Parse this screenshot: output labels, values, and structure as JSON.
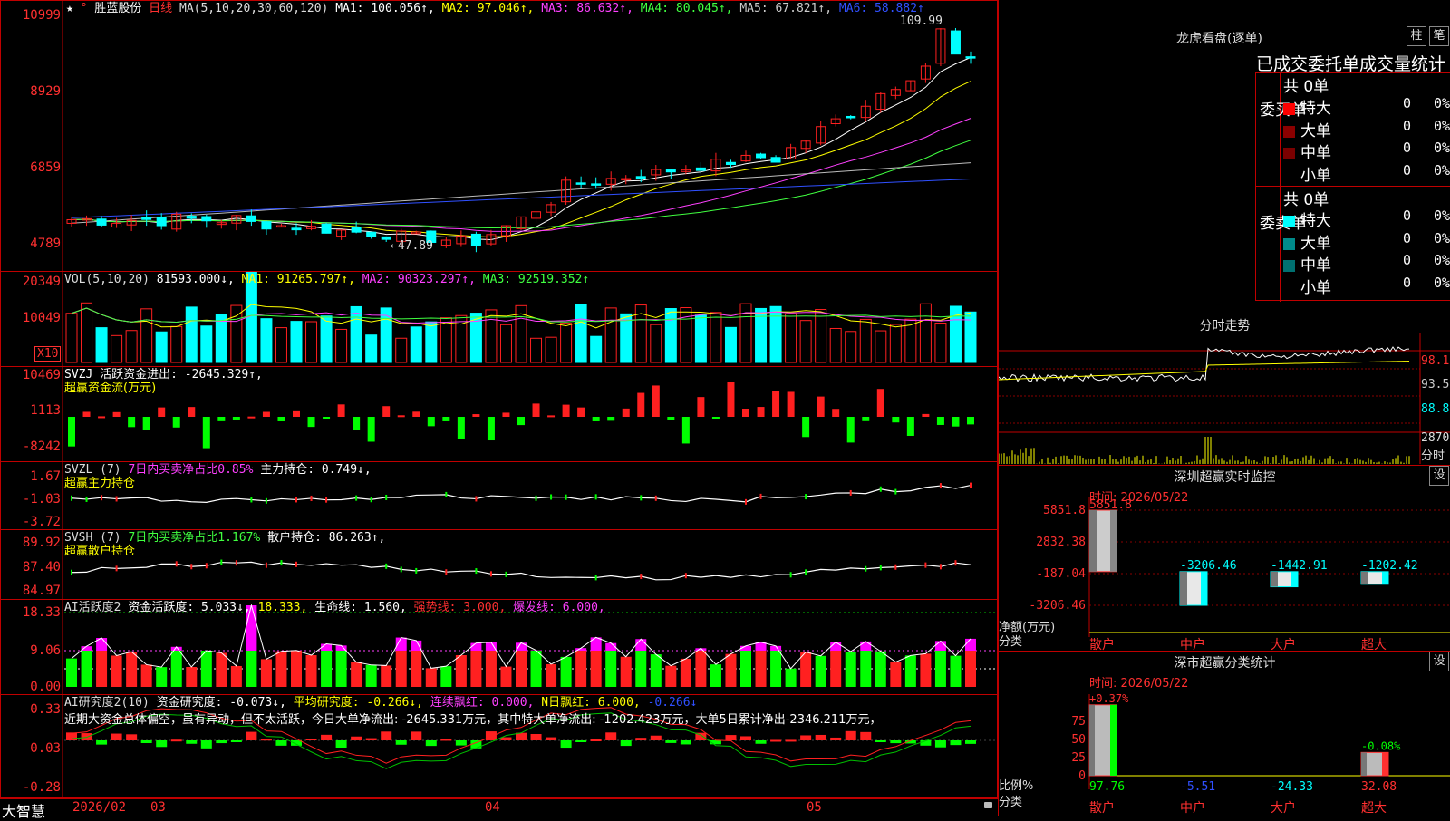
{
  "stock": {
    "star": "★",
    "marker": "°",
    "name": "胜蓝股份",
    "period": "日线"
  },
  "main_header": {
    "ma_param": "MA(5,10,20,30,60,120)",
    "ma1": "MA1: 100.056↑,",
    "ma2": "MA2: 97.046↑,",
    "ma3": "MA3: 86.632↑,",
    "ma4": "MA4: 80.045↑,",
    "ma5": "MA5: 67.821↑,",
    "ma6": "MA6: 58.882↑"
  },
  "main_axis": [
    "10999",
    "8929",
    "6859",
    "4789"
  ],
  "annotations": {
    "high": "109.99",
    "low": "←47.89"
  },
  "vol": {
    "header": "VOL(5,10,20)",
    "value": "81593.000↓,",
    "ma1": "MA1: 91265.797↑,",
    "ma2": "MA2: 90323.297↑,",
    "ma3": "MA3: 92519.352↑",
    "axis": [
      "20349",
      "10049"
    ],
    "unit": "X10"
  },
  "svzj": {
    "header": "SVZJ  活跃资金进出: -2645.329↑,",
    "label": "超赢资金流(万元)",
    "axis": [
      "10469",
      "1113",
      "-8242"
    ]
  },
  "svzl": {
    "name": "SVZL (7)",
    "desc": "7日内买卖净占比0.85%",
    "value": "主力持仓: 0.749↓,",
    "label": "超赢主力持仓",
    "axis": [
      "1.67",
      "-1.03",
      "-3.72"
    ]
  },
  "svsh": {
    "name": "SVSH (7)",
    "desc": "7日内买卖净占比1.167%",
    "value": "散户持仓: 86.263↑,",
    "label": "超赢散户持仓",
    "axis": [
      "89.92",
      "87.40",
      "84.97"
    ]
  },
  "ai1": {
    "name": "AI活跃度2",
    "v1": "资金活跃度: 5.033↓,",
    "v2": "18.333,",
    "v3": "生命线: 1.560,",
    "v4": "强势线: 3.000,",
    "v5": "爆发线: 6.000,",
    "axis": [
      "18.33",
      "9.06",
      "0.00"
    ]
  },
  "ai2": {
    "name": "AI研究度2(10)",
    "v1": "资金研究度: -0.073↓,",
    "v2": "平均研究度: -0.266↓,",
    "v3": "连续飘红: 0.000,",
    "v4": "N日飘红: 6.000,",
    "v5": "-0.266↓",
    "comment": "近期大资金总体偏空，虽有异动，但不太活跃，今日大单净流出: -2645.331万元，其中特大单净流出: -1202.423万元，大单5日累计净出-2346.211万元，",
    "axis": [
      "0.33",
      "0.03",
      "-0.28"
    ]
  },
  "date_axis": {
    "brand": "大智慧",
    "labels": [
      "2026/02",
      "03",
      "04",
      "05"
    ]
  },
  "lhb": {
    "title": "龙虎看盘(逐单)",
    "btn1": "柱",
    "btn2": "笔",
    "tabs": "已成交委托单成交量统计",
    "buy_side": {
      "label": "委买单",
      "total": "共 0单",
      "rows": [
        {
          "name": "特大",
          "count": "0",
          "pct": "0%",
          "color": "#ff0000"
        },
        {
          "name": "大单",
          "count": "0",
          "pct": "0%",
          "color": "#8b0000"
        },
        {
          "name": "中单",
          "count": "0",
          "pct": "0%",
          "color": "#7a0000"
        },
        {
          "name": "小单",
          "count": "0",
          "pct": "0%",
          "color": "#000000"
        }
      ]
    },
    "sell_side": {
      "label": "委卖单",
      "total": "共 0单",
      "rows": [
        {
          "name": "特大",
          "count": "0",
          "pct": "0%",
          "color": "#00ffff"
        },
        {
          "name": "大单",
          "count": "0",
          "pct": "0%",
          "color": "#008b8b"
        },
        {
          "name": "中单",
          "count": "0",
          "pct": "0%",
          "color": "#007070"
        },
        {
          "name": "小单",
          "count": "0",
          "pct": "0%",
          "color": "#000000"
        }
      ]
    }
  },
  "intraday": {
    "title": "分时走势",
    "axis": [
      "98.1",
      "93.5",
      "88.8"
    ],
    "vol_label": "2870",
    "vol_sub": "分时"
  },
  "sz_monitor": {
    "title": "深圳超赢实时监控",
    "btn": "设",
    "time": "时间: 2026/05/22",
    "axis": [
      "5851.8",
      "2832.38",
      "-187.04",
      "-3206.46"
    ],
    "unit_label": "净额(万元)",
    "cat_label": "分类",
    "bars": [
      {
        "name": "散户",
        "value": 5851.8,
        "label": "5851.8"
      },
      {
        "name": "中户",
        "value": -3206.46,
        "label": "-3206.46"
      },
      {
        "name": "大户",
        "value": -1442.91,
        "label": "-1442.91"
      },
      {
        "name": "超大",
        "value": -1202.42,
        "label": "-1202.42"
      }
    ]
  },
  "sz_class": {
    "title": "深市超赢分类统计",
    "btn": "设",
    "time": "时间: 2026/05/22",
    "axis": [
      "75",
      "50",
      "25",
      "0"
    ],
    "ratio_label": "比例%",
    "cat_label": "分类",
    "bars": [
      {
        "name": "散户",
        "value": 97.76,
        "label": "97.76",
        "top": "+0.37%"
      },
      {
        "name": "中户",
        "value": -5.51,
        "label": "-5.51",
        "top": ""
      },
      {
        "name": "大户",
        "value": -24.33,
        "label": "-24.33",
        "top": ""
      },
      {
        "name": "超大",
        "value": 32.08,
        "label": "32.08",
        "top": "-0.08%"
      }
    ]
  },
  "colors": {
    "up": "#ff2020",
    "down": "#00ffff",
    "panel_border": "#c00000"
  }
}
